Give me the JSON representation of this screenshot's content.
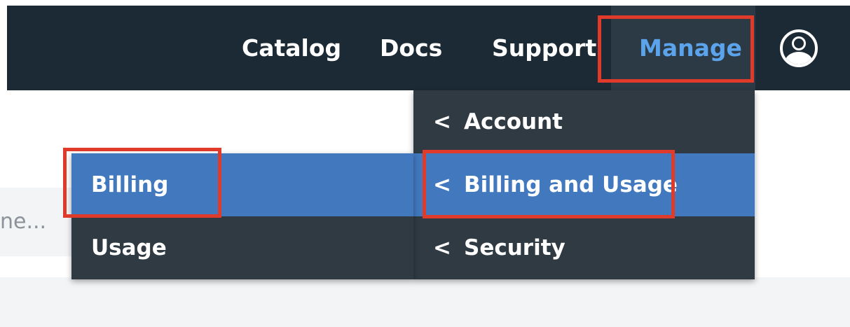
{
  "topnav": {
    "items": [
      "Catalog",
      "Docs",
      "Support",
      "Manage"
    ]
  },
  "avatar_icon": "user-avatar-icon",
  "search": {
    "text": "ne..."
  },
  "manage_menu": {
    "items": [
      {
        "label": "Account",
        "icon": "chevron-left-icon",
        "glyph": "<"
      },
      {
        "label": "Billing and Usage",
        "icon": "chevron-left-icon",
        "glyph": "<"
      },
      {
        "label": "Security",
        "icon": "chevron-left-icon",
        "glyph": "<"
      }
    ]
  },
  "billing_submenu": {
    "items": [
      {
        "label": "Billing"
      },
      {
        "label": "Usage"
      }
    ]
  },
  "colors": {
    "topbar": "#1c2a35",
    "manage_active_text": "#5ba4eb",
    "menu_bg": "#2f3a42",
    "selected_row": "#4178be",
    "highlight": "#e03a2b"
  }
}
